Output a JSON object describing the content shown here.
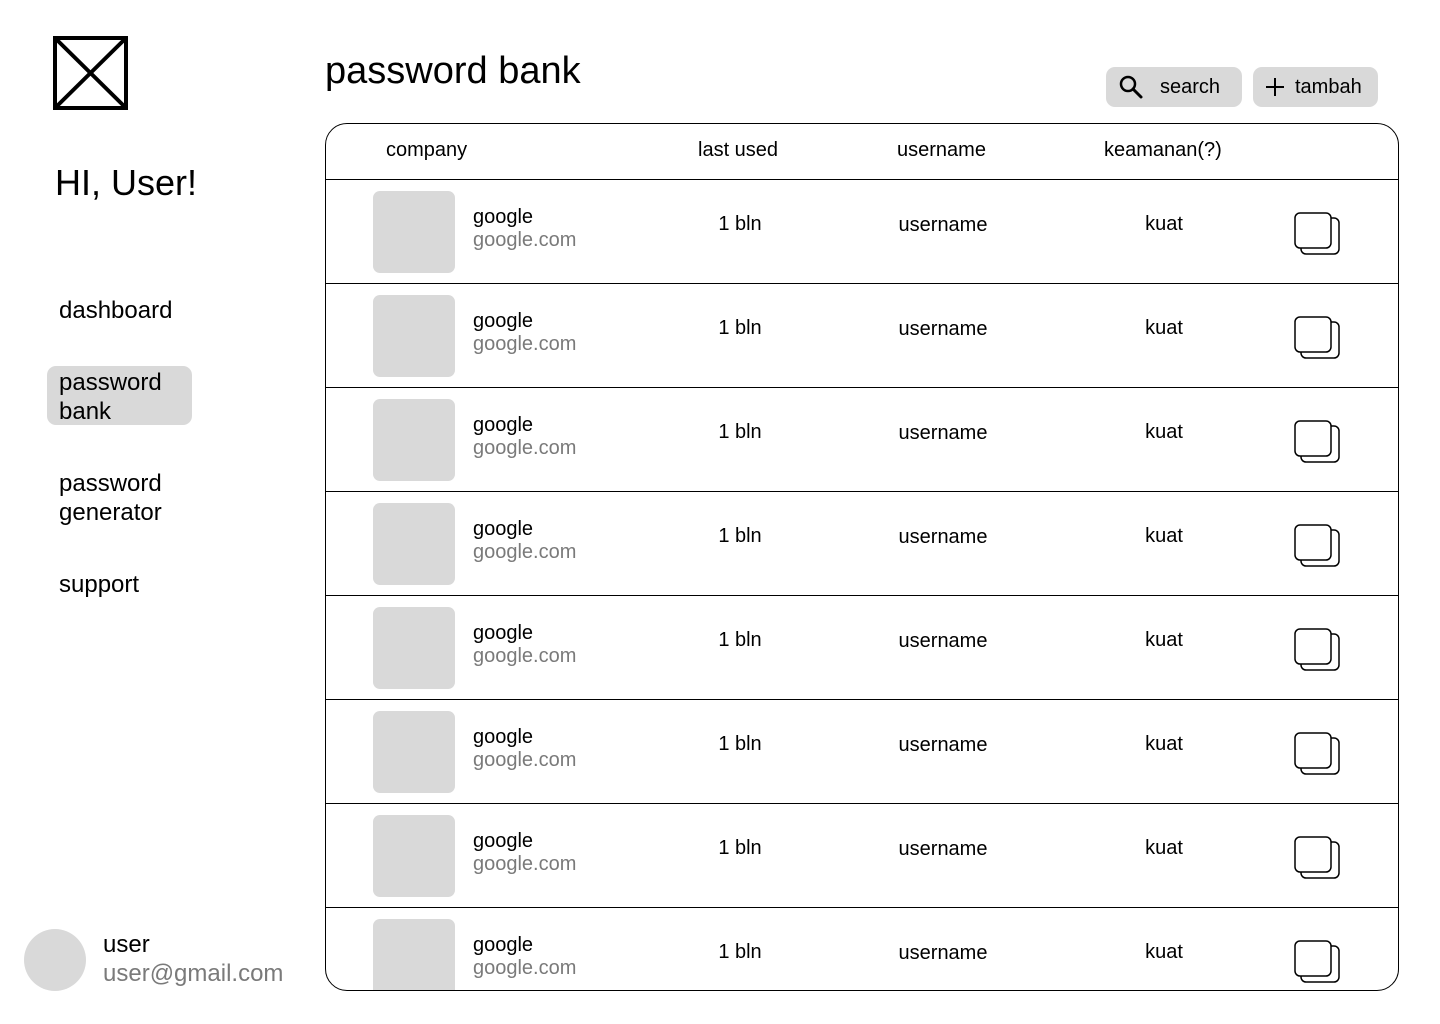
{
  "sidebar": {
    "greeting": "HI, User!",
    "nav": [
      {
        "label": "dashboard"
      },
      {
        "label": "password bank"
      },
      {
        "label": "password generator"
      },
      {
        "label": "support"
      }
    ],
    "user": {
      "name": "user",
      "email": "user@gmail.com"
    }
  },
  "header": {
    "title": "password bank",
    "search_label": "search",
    "add_label": "tambah"
  },
  "table": {
    "columns": [
      "company",
      "last used",
      "username",
      "keamanan(?)"
    ],
    "rows": [
      {
        "company": "google",
        "domain": "google.com",
        "last_used": "1 bln",
        "username": "username",
        "security": "kuat"
      },
      {
        "company": "google",
        "domain": "google.com",
        "last_used": "1 bln",
        "username": "username",
        "security": "kuat"
      },
      {
        "company": "google",
        "domain": "google.com",
        "last_used": "1 bln",
        "username": "username",
        "security": "kuat"
      },
      {
        "company": "google",
        "domain": "google.com",
        "last_used": "1 bln",
        "username": "username",
        "security": "kuat"
      },
      {
        "company": "google",
        "domain": "google.com",
        "last_used": "1 bln",
        "username": "username",
        "security": "kuat"
      },
      {
        "company": "google",
        "domain": "google.com",
        "last_used": "1 bln",
        "username": "username",
        "security": "kuat"
      },
      {
        "company": "google",
        "domain": "google.com",
        "last_used": "1 bln",
        "username": "username",
        "security": "kuat"
      },
      {
        "company": "google",
        "domain": "google.com",
        "last_used": "1 bln",
        "username": "username",
        "security": "kuat"
      }
    ]
  },
  "icons": {
    "logo": "logo-placeholder-icon",
    "search": "search-icon",
    "add": "plus-icon",
    "copy": "copy-icon"
  },
  "colors": {
    "accent_bg": "#d9d9d9",
    "muted_text": "#7a7a7a",
    "border": "#000000"
  }
}
